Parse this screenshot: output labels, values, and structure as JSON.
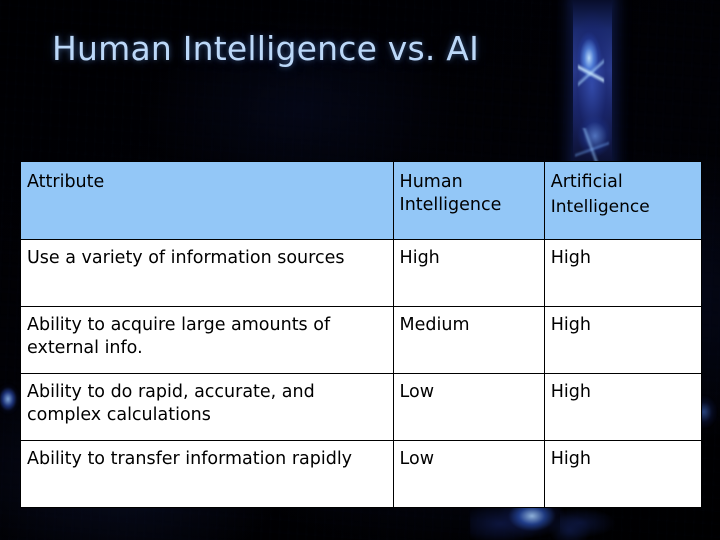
{
  "slide": {
    "title": "Human Intelligence vs. AI",
    "title_color": "#bcd8f8",
    "background_color": "#010104",
    "header_fill": "#93c7f7",
    "body_fill": "#ffffff",
    "border_color": "#000000"
  },
  "table": {
    "headers": {
      "attribute": "Attribute",
      "human_line1": "Human",
      "human_line2": "Intelligence",
      "ai_line1": "Artificial",
      "ai_line2": "Intelligence"
    },
    "rows": [
      {
        "attribute": "Use a variety of information sources",
        "human": "High",
        "ai": "High"
      },
      {
        "attribute": "Ability to acquire large amounts of external info.",
        "human": "Medium",
        "ai": "High"
      },
      {
        "attribute": "Ability to do rapid, accurate, and complex calculations",
        "human": "Low",
        "ai": "High"
      },
      {
        "attribute": "Ability to transfer information rapidly",
        "human": "Low",
        "ai": "High"
      }
    ]
  }
}
